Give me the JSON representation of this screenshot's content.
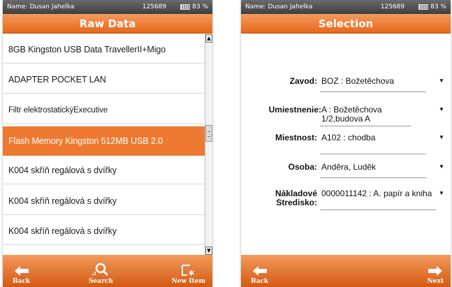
{
  "status": {
    "user": "Name: Dusan Jahelka",
    "code": "125689",
    "battery": "83 %"
  },
  "raw_data": {
    "title": "Raw Data",
    "items": [
      "8GB Kingston USB Data TravellerII+Migo",
      "ADAPTER POCKET LAN",
      "Filtr elektrostatickýExecutive",
      "Flash Memory Kingston 512MB USB 2.0",
      "K004 skříň regálová s dvířky",
      "K004 skříň regálová s dvířky",
      "K004 skříň regálová s dvířky"
    ],
    "selected_index": 3,
    "buttons": {
      "back": "Back",
      "search": "Search",
      "new_item": "New Item"
    }
  },
  "selection": {
    "title": "Selection",
    "fields": [
      {
        "label": "Zavod:",
        "value": "BOZ : Božetěchova"
      },
      {
        "label": "Umiestnenie:",
        "value": "A : Božetěchova 1/2,budova A"
      },
      {
        "label": "Miestnost:",
        "value": "A102 : chodba"
      },
      {
        "label": "Osoba:",
        "value": "Anděra, Luděk"
      },
      {
        "label": "Nákladové Stredisko:",
        "value": "0000011142 : A. papír a kniha"
      }
    ],
    "buttons": {
      "back": "Back",
      "next": "Next"
    }
  },
  "icons": [
    "battery-icon",
    "back-arrow-icon",
    "search-icon",
    "new-item-icon",
    "next-arrow-icon",
    "scroll-up-icon",
    "scroll-down-icon",
    "dropdown-caret-icon"
  ]
}
